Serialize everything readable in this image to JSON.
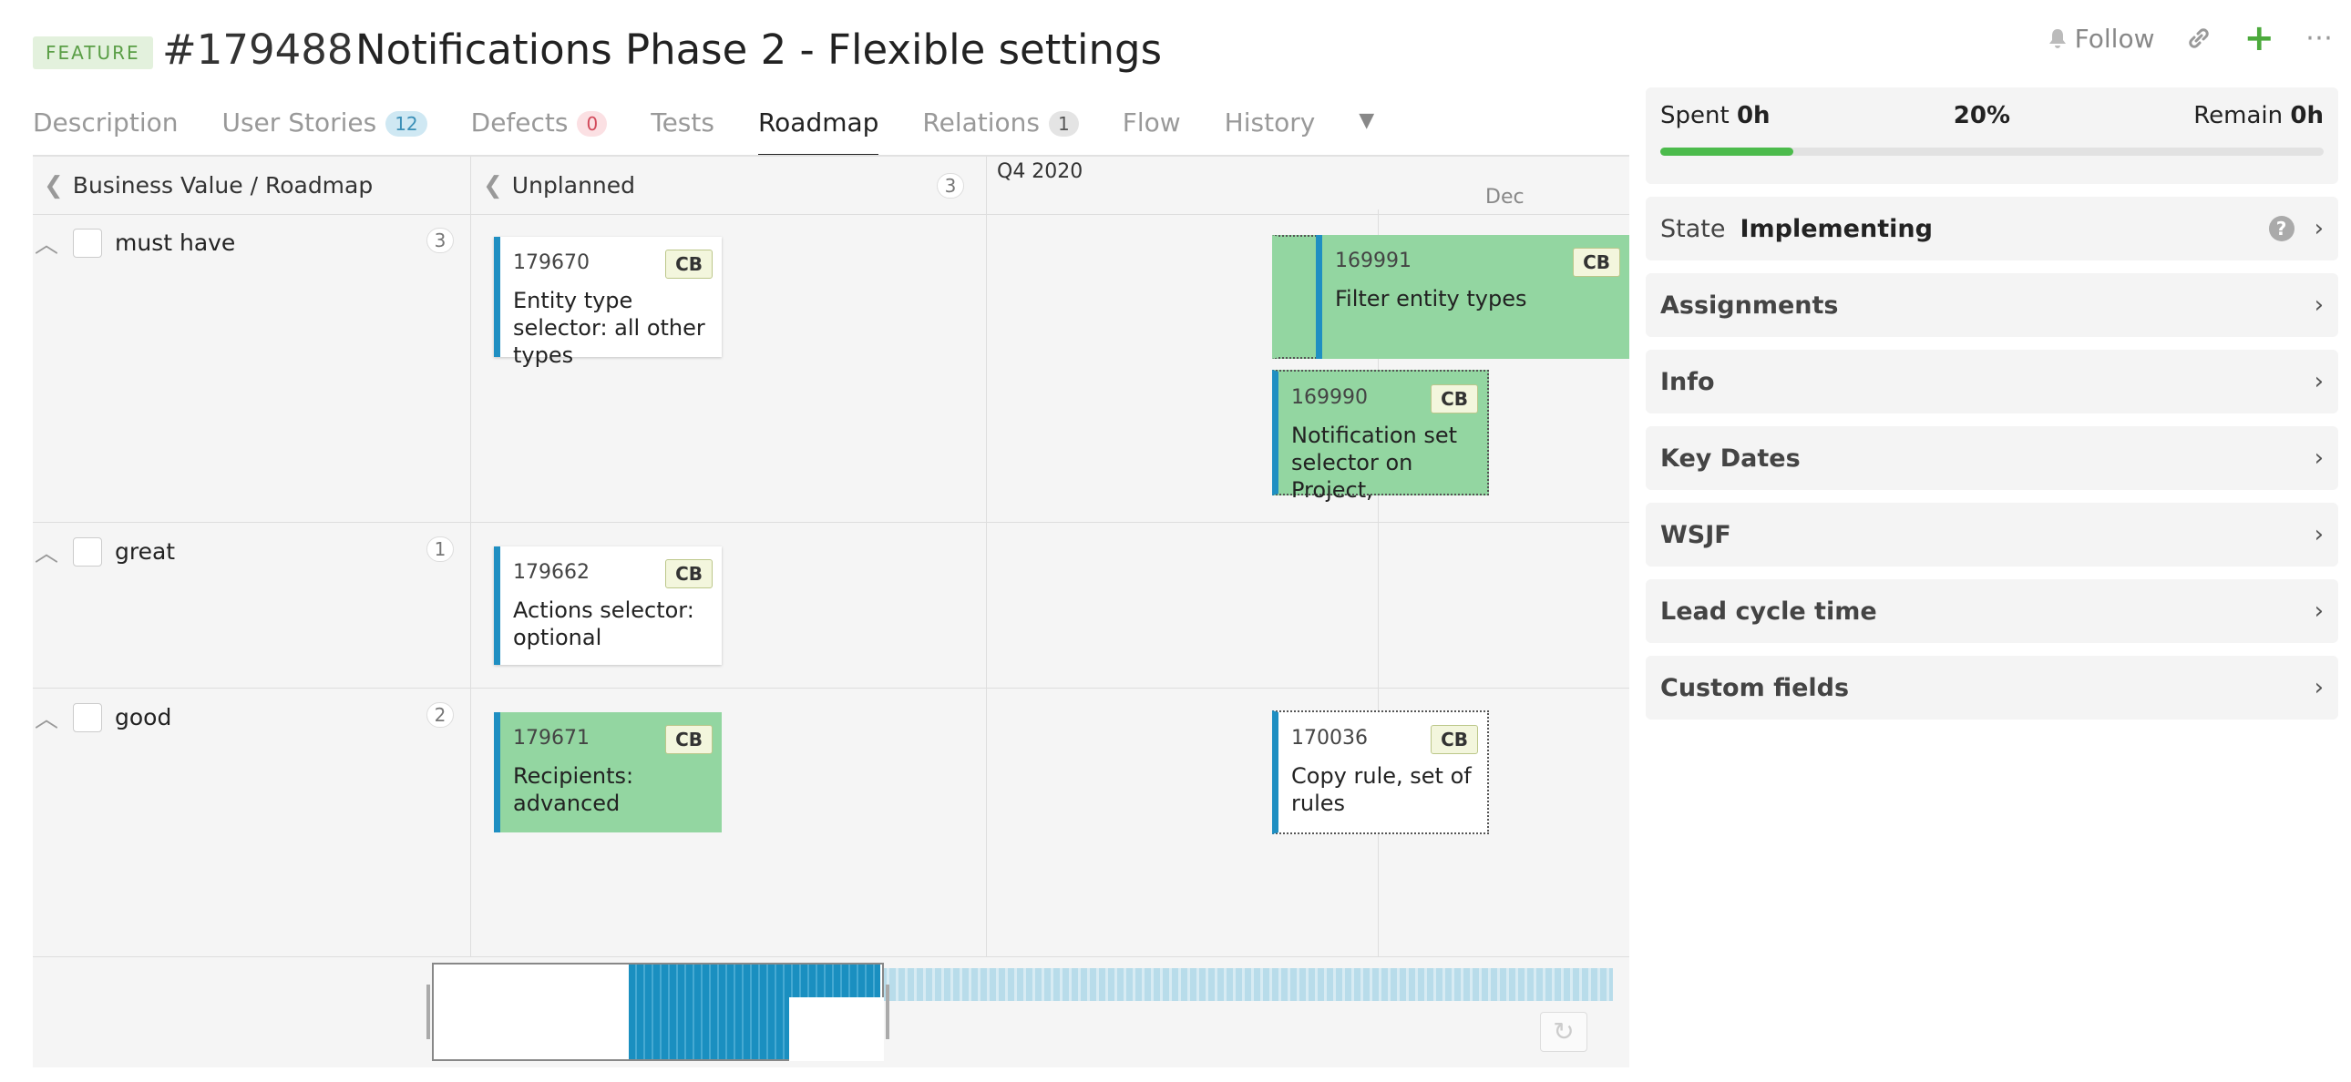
{
  "header": {
    "type_badge": "FEATURE",
    "id": "#179488",
    "title": "Notifications Phase 2 - Flexible settings",
    "follow_label": "Follow"
  },
  "tabs": [
    {
      "label": "Description",
      "count": null
    },
    {
      "label": "User Stories",
      "count": "12"
    },
    {
      "label": "Defects",
      "count": "0"
    },
    {
      "label": "Tests",
      "count": null
    },
    {
      "label": "Roadmap",
      "count": null,
      "active": true
    },
    {
      "label": "Relations",
      "count": "1"
    },
    {
      "label": "Flow",
      "count": null
    },
    {
      "label": "History",
      "count": null
    }
  ],
  "roadmap": {
    "axis_header": "Business Value / Roadmap",
    "unplanned_header": "Unplanned",
    "unplanned_count": "3",
    "quarter_label": "Q4 2020",
    "month_label": "Dec",
    "rows": [
      {
        "label": "must have",
        "count": "3"
      },
      {
        "label": "great",
        "count": "1"
      },
      {
        "label": "good",
        "count": "2"
      }
    ],
    "cards": [
      {
        "id": "179670",
        "tag": "CB",
        "text": "Entity type selector: all other types"
      },
      {
        "id": "169991",
        "tag": "CB",
        "text": "Filter entity types"
      },
      {
        "id": "169990",
        "tag": "CB",
        "text": "Notification set selector on Project,"
      },
      {
        "id": "179662",
        "tag": "CB",
        "text": "Actions selector: optional"
      },
      {
        "id": "179671",
        "tag": "CB",
        "text": "Recipients: advanced"
      },
      {
        "id": "170036",
        "tag": "CB",
        "text": "Copy rule, set of rules"
      }
    ]
  },
  "panel": {
    "spent_label": "Spent",
    "spent_value": "0h",
    "percent": "20%",
    "progress_fraction": 0.2,
    "remain_label": "Remain",
    "remain_value": "0h",
    "state_label": "State",
    "state_value": "Implementing",
    "sections": [
      "Assignments",
      "Info",
      "Key Dates",
      "WSJF",
      "Lead cycle time",
      "Custom fields"
    ]
  },
  "colors": {
    "accent_blue": "#1f8fc2",
    "card_green": "#93d6a1",
    "progress_green": "#4cbb4c",
    "badge_green": "#5a9e46"
  },
  "icons": [
    "bell-icon",
    "link-icon",
    "plus-icon",
    "more-icon",
    "chevron-left-icon",
    "chevron-up-icon",
    "chevron-right-icon",
    "help-icon",
    "refresh-icon",
    "dropdown-icon"
  ]
}
